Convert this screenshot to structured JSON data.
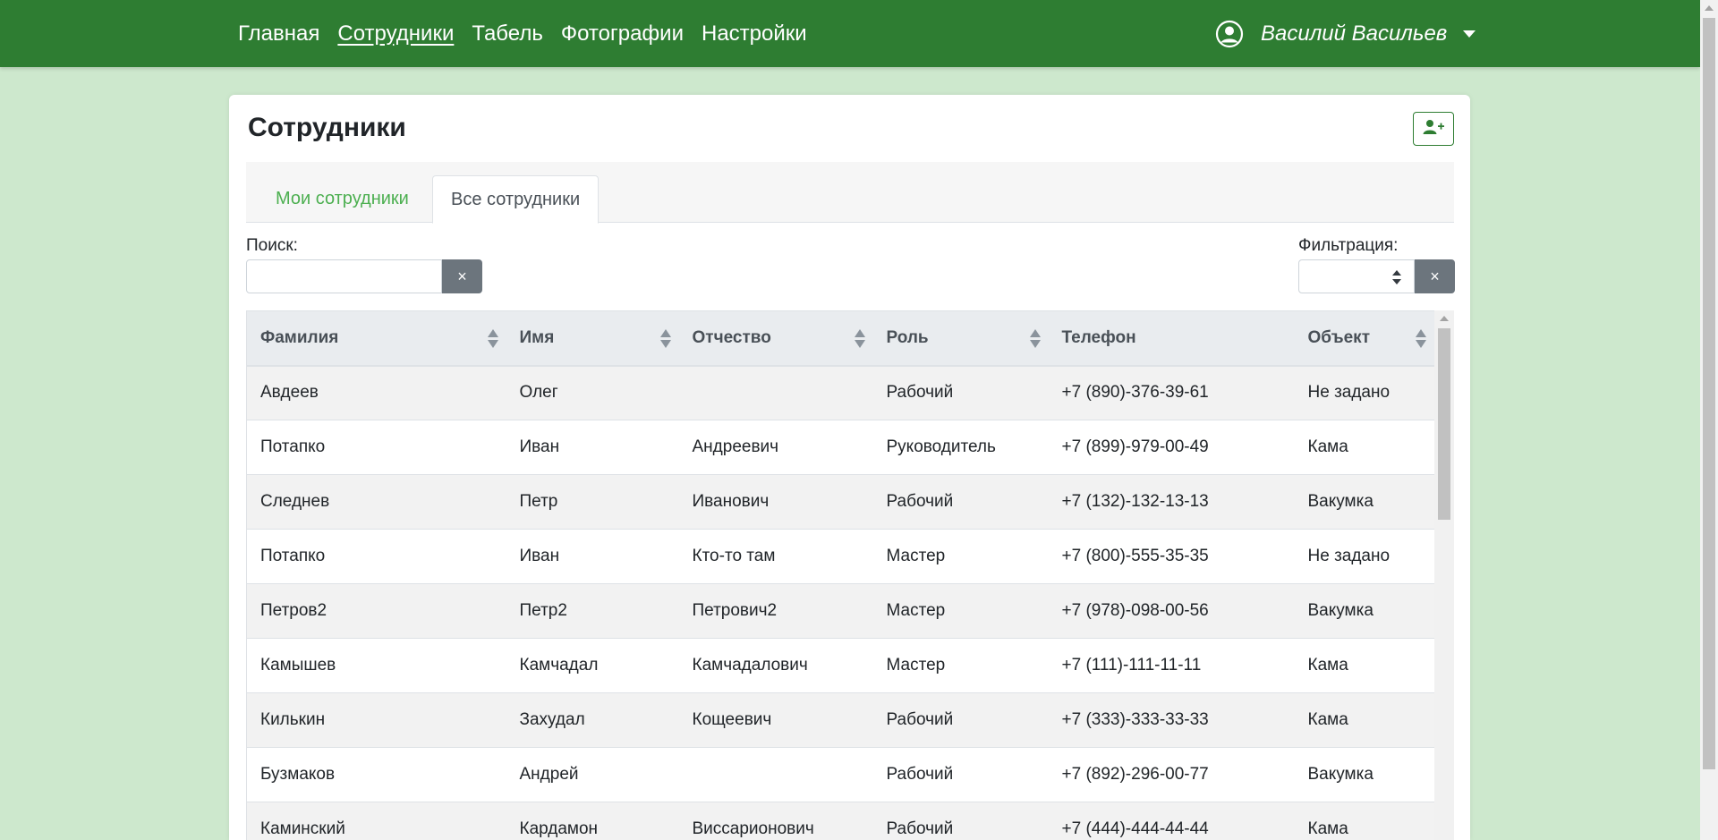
{
  "nav": {
    "links": [
      "Главная",
      "Сотрудники",
      "Табель",
      "Фотографии",
      "Настройки"
    ],
    "active": "Сотрудники",
    "user_name": "Василий Васильев"
  },
  "page": {
    "title": "Сотрудники",
    "tabs": [
      "Мои сотрудники",
      "Все сотрудники"
    ],
    "active_tab": "Все сотрудники",
    "search_label": "Поиск:",
    "search_value": "",
    "clear_symbol": "×",
    "filter_label": "Фильтрация:",
    "filter_value": ""
  },
  "table": {
    "columns": [
      "Фамилия",
      "Имя",
      "Отчество",
      "Роль",
      "Телефон",
      "Объект"
    ],
    "rows": [
      [
        "Авдеев",
        "Олег",
        "",
        "Рабочий",
        "+7 (890)-376-39-61",
        "Не задано"
      ],
      [
        "Потапко",
        "Иван",
        "Андреевич",
        "Руководитель",
        "+7 (899)-979-00-49",
        "Кама"
      ],
      [
        "Следнев",
        "Петр",
        "Иванович",
        "Рабочий",
        "+7 (132)-132-13-13",
        "Вакумка"
      ],
      [
        "Потапко",
        "Иван",
        "Кто-то там",
        "Мастер",
        "+7 (800)-555-35-35",
        "Не задано"
      ],
      [
        "Петров2",
        "Петр2",
        "Петрович2",
        "Мастер",
        "+7 (978)-098-00-56",
        "Вакумка"
      ],
      [
        "Камышев",
        "Камчадал",
        "Камчадалович",
        "Мастер",
        "+7 (111)-111-11-11",
        "Кама"
      ],
      [
        "Килькин",
        "Захудал",
        "Кощеевич",
        "Рабочий",
        "+7 (333)-333-33-33",
        "Кама"
      ],
      [
        "Бузмаков",
        "Андрей",
        "",
        "Рабочий",
        "+7 (892)-296-00-77",
        "Вакумка"
      ],
      [
        "Каминский",
        "Кардамон",
        "Виссарионович",
        "Рабочий",
        "+7 (444)-444-44-44",
        "Кама"
      ]
    ]
  },
  "icons": {
    "user": "user-circle-icon",
    "add_user": "user-plus-icon",
    "clear": "close-icon",
    "sort": "sort-icon"
  },
  "colors": {
    "navbar": "#2e7d32",
    "background": "#cde8cd",
    "accent": "#4caf50",
    "button_secondary": "#6c757d"
  }
}
